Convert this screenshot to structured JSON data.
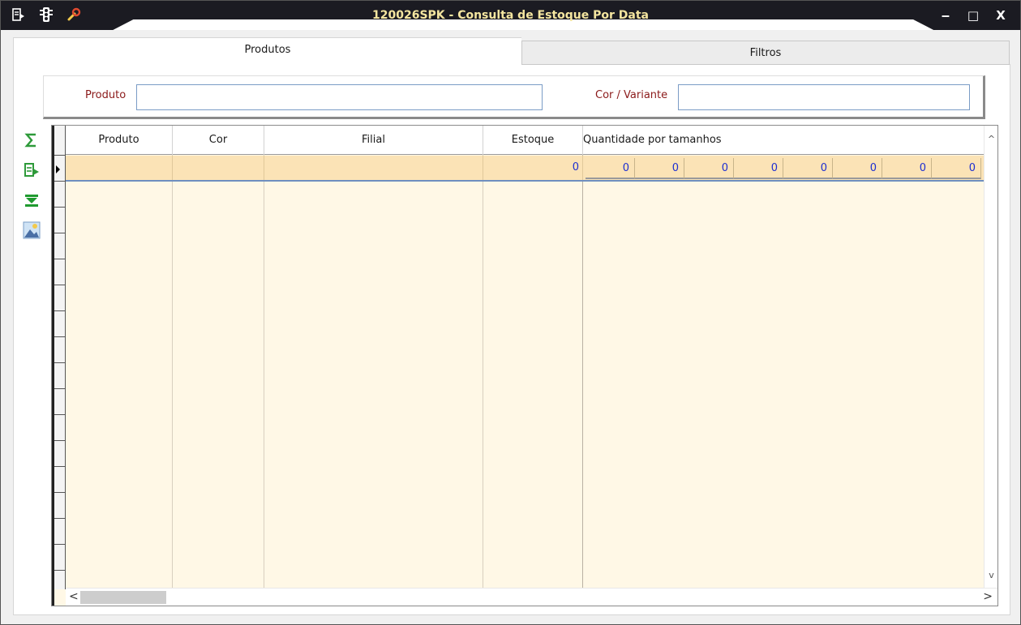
{
  "window": {
    "title": "120026SPK - Consulta de Estoque Por Data",
    "title_color": "#f5e6a0",
    "titlebar_color": "#1b1b22",
    "controls": {
      "minimize": "‒",
      "maximize": "□",
      "close": "X"
    }
  },
  "tabs": [
    {
      "label": "Produtos",
      "active": true
    },
    {
      "label": "Filtros",
      "active": false
    }
  ],
  "filters": {
    "produto_label": "Produto",
    "produto_value": "",
    "cor_label": "Cor / Variante",
    "cor_value": "",
    "label_color": "#8b1a1a"
  },
  "side_tools": [
    "sum-icon",
    "export-icon",
    "expand-down-icon",
    "image-icon"
  ],
  "grid": {
    "columns": [
      "Produto",
      "Cor",
      "Filial",
      "Estoque",
      "Quantidade por tamanhos"
    ],
    "rows": [
      {
        "produto": "",
        "cor": "",
        "filial": "",
        "estoque": "0",
        "sizes": [
          "0",
          "0",
          "0",
          "0",
          "0",
          "0",
          "0",
          "0"
        ]
      }
    ],
    "row_color": "#fbe3b6",
    "value_color": "#1e2fd1",
    "empty_area_color": "#fff8e6"
  },
  "scroll": {
    "up": "^",
    "down": "v",
    "left": "<",
    "right": ">"
  }
}
